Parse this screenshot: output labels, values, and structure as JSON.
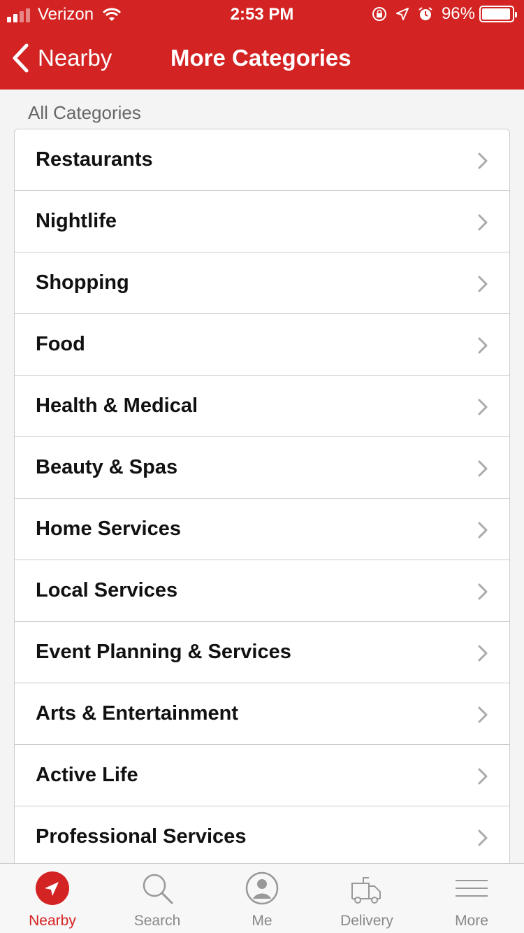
{
  "status_bar": {
    "carrier": "Verizon",
    "time": "2:53 PM",
    "battery_percent": "96%",
    "battery_level": 0.96
  },
  "nav": {
    "back_label": "Nearby",
    "title": "More Categories"
  },
  "section_label": "All Categories",
  "categories": [
    "Restaurants",
    "Nightlife",
    "Shopping",
    "Food",
    "Health & Medical",
    "Beauty & Spas",
    "Home Services",
    "Local Services",
    "Event Planning & Services",
    "Arts & Entertainment",
    "Active Life",
    "Professional Services"
  ],
  "tabs": [
    {
      "label": "Nearby",
      "icon": "location-arrow-icon",
      "active": true
    },
    {
      "label": "Search",
      "icon": "search-icon",
      "active": false
    },
    {
      "label": "Me",
      "icon": "user-icon",
      "active": false
    },
    {
      "label": "Delivery",
      "icon": "delivery-truck-icon",
      "active": false
    },
    {
      "label": "More",
      "icon": "menu-icon",
      "active": false
    }
  ],
  "colors": {
    "brand": "#d32323",
    "tab_inactive": "#888888"
  }
}
